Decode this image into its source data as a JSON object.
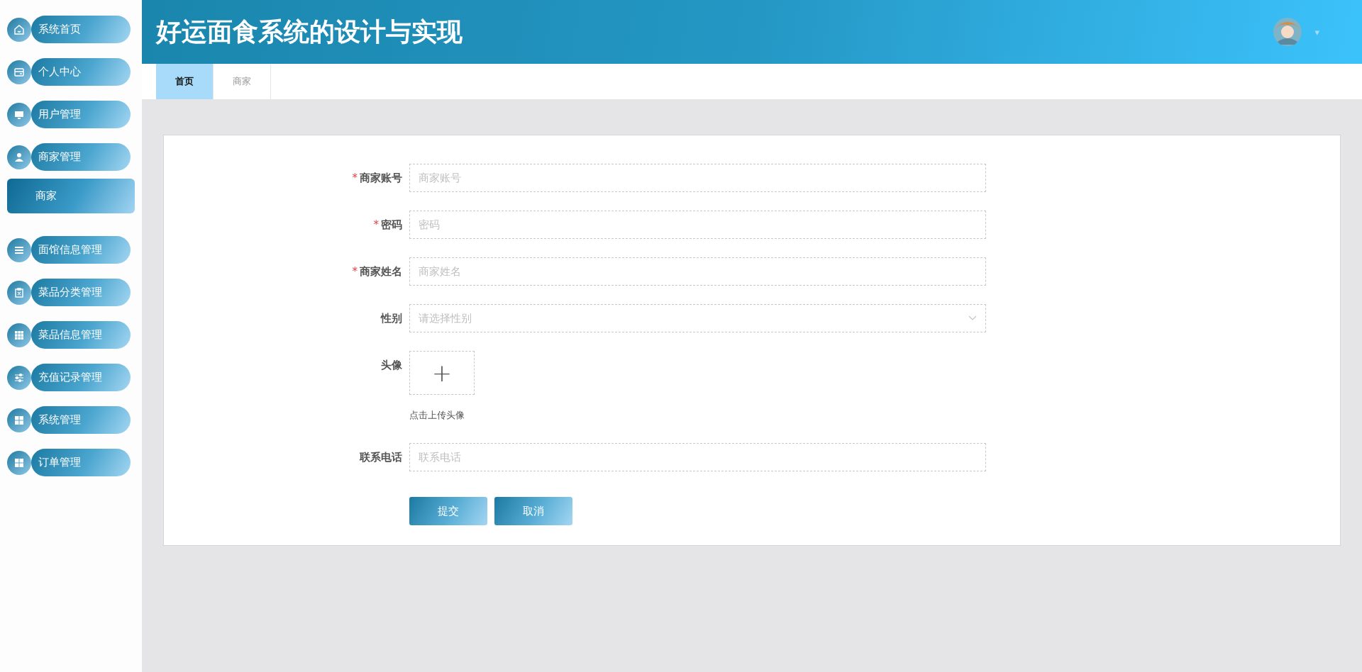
{
  "header": {
    "title": "好运面食系统的设计与实现",
    "caret": "▾"
  },
  "sidebar": {
    "items": [
      {
        "label": "系统首页"
      },
      {
        "label": "个人中心"
      },
      {
        "label": "用户管理"
      },
      {
        "label": "商家管理",
        "children": [
          {
            "label": "商家",
            "selected": true
          }
        ]
      },
      {
        "label": "面馆信息管理"
      },
      {
        "label": "菜品分类管理"
      },
      {
        "label": "菜品信息管理"
      },
      {
        "label": "充值记录管理"
      },
      {
        "label": "系统管理"
      },
      {
        "label": "订单管理"
      }
    ]
  },
  "tabs": [
    {
      "label": "首页",
      "selected": true
    },
    {
      "label": "商家",
      "selected": false
    }
  ],
  "form": {
    "fields": [
      {
        "kind": "text",
        "label": "商家账号",
        "required": true,
        "placeholder": "商家账号"
      },
      {
        "kind": "text",
        "label": "密码",
        "required": true,
        "placeholder": "密码"
      },
      {
        "kind": "text",
        "label": "商家姓名",
        "required": true,
        "placeholder": "商家姓名"
      },
      {
        "kind": "select",
        "label": "性别",
        "required": false,
        "placeholder": "请选择性别"
      },
      {
        "kind": "upload",
        "label": "头像",
        "required": false,
        "plus": "+",
        "hint": "点击上传头像"
      },
      {
        "kind": "text",
        "label": "联系电话",
        "required": false,
        "placeholder": "联系电话"
      }
    ],
    "required_mark": "*",
    "buttons": [
      "提交",
      "取消"
    ]
  }
}
